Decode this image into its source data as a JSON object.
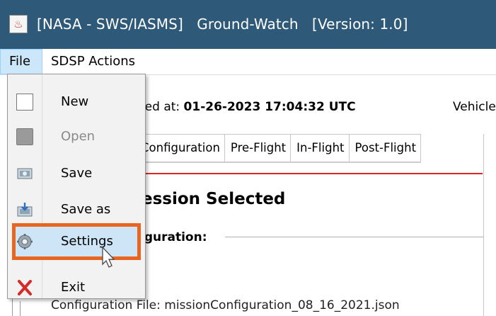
{
  "window": {
    "title": "[NASA - SWS/IASMS]   Ground-Watch   [Version: 1.0]",
    "app_icon": "java-cup-icon"
  },
  "menubar": {
    "file_label": "File",
    "sdsp_label": "SDSP Actions"
  },
  "file_menu": {
    "items": [
      {
        "label": "New",
        "icon": "new-document-icon",
        "enabled": true
      },
      {
        "label": "Open",
        "icon": "open-icon",
        "enabled": false
      },
      {
        "label": "Save",
        "icon": "save-icon",
        "enabled": true
      },
      {
        "label": "Save as",
        "icon": "save-as-icon",
        "enabled": true
      },
      {
        "label": "Settings",
        "icon": "gear-icon",
        "enabled": true,
        "highlighted": true
      },
      {
        "label": "Exit",
        "icon": "exit-x-icon",
        "enabled": true
      }
    ],
    "highlight_color": "#e8661f"
  },
  "background": {
    "updated_prefix": "ted at: ",
    "updated_value": "01-26-2023 17:04:32 UTC",
    "vehicle_label": "Vehicle",
    "tabs": [
      "Configuration",
      "Pre-Flight",
      "In-Flight",
      "Post-Flight"
    ],
    "mission_heading": "ession Selected",
    "config_legend": "iguration:",
    "config_file": "Configuration File: missionConfiguration_08_16_2021.json"
  },
  "colors": {
    "titlebar": "#2e5978",
    "accent_red": "#e02424",
    "menu_selected": "#cce6fa"
  }
}
